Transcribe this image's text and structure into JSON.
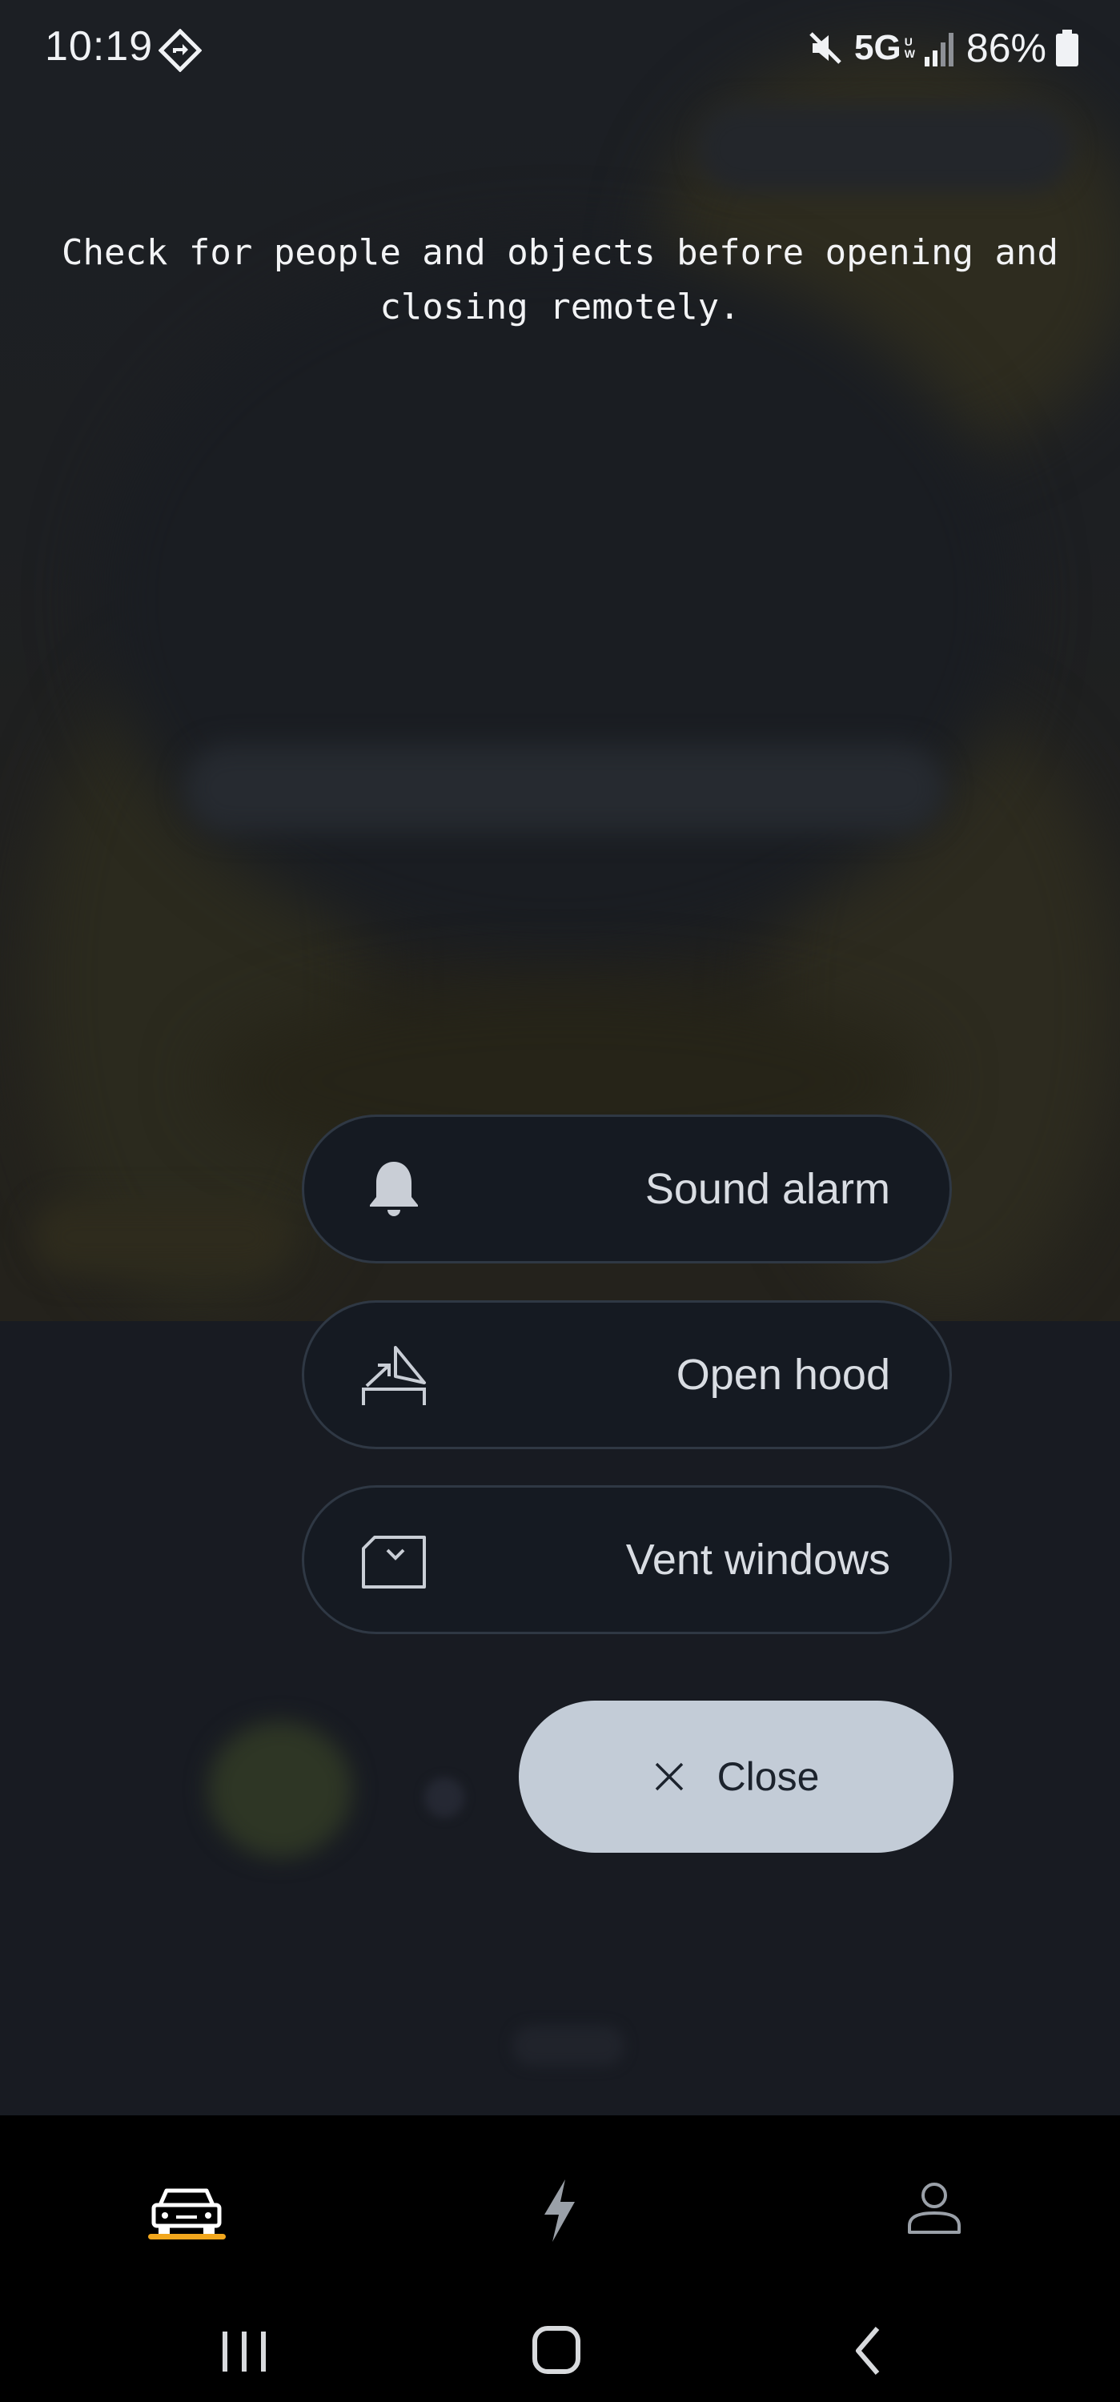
{
  "status_bar": {
    "time": "10:19",
    "network": "5G",
    "network_sub_1": "U",
    "network_sub_2": "W",
    "battery": "86%",
    "icons": [
      "nav-diamond-icon",
      "mute-icon",
      "signal-icon",
      "battery-icon"
    ]
  },
  "warning_text": "Check for people and objects before opening and closing remotely.",
  "actions": [
    {
      "label": "Sound alarm",
      "icon": "bell-icon"
    },
    {
      "label": "Open hood",
      "icon": "hood-icon"
    },
    {
      "label": "Vent windows",
      "icon": "window-vent-icon"
    }
  ],
  "close_button": {
    "label": "Close",
    "icon": "close-icon"
  },
  "bottom_nav": {
    "items": [
      {
        "icon": "vehicle-icon",
        "active": true
      },
      {
        "icon": "lightning-icon",
        "active": false
      },
      {
        "icon": "profile-icon",
        "active": false
      }
    ],
    "accent_color": "#f2a71d"
  },
  "system_nav": [
    "recent-apps-icon",
    "home-icon",
    "back-icon"
  ]
}
